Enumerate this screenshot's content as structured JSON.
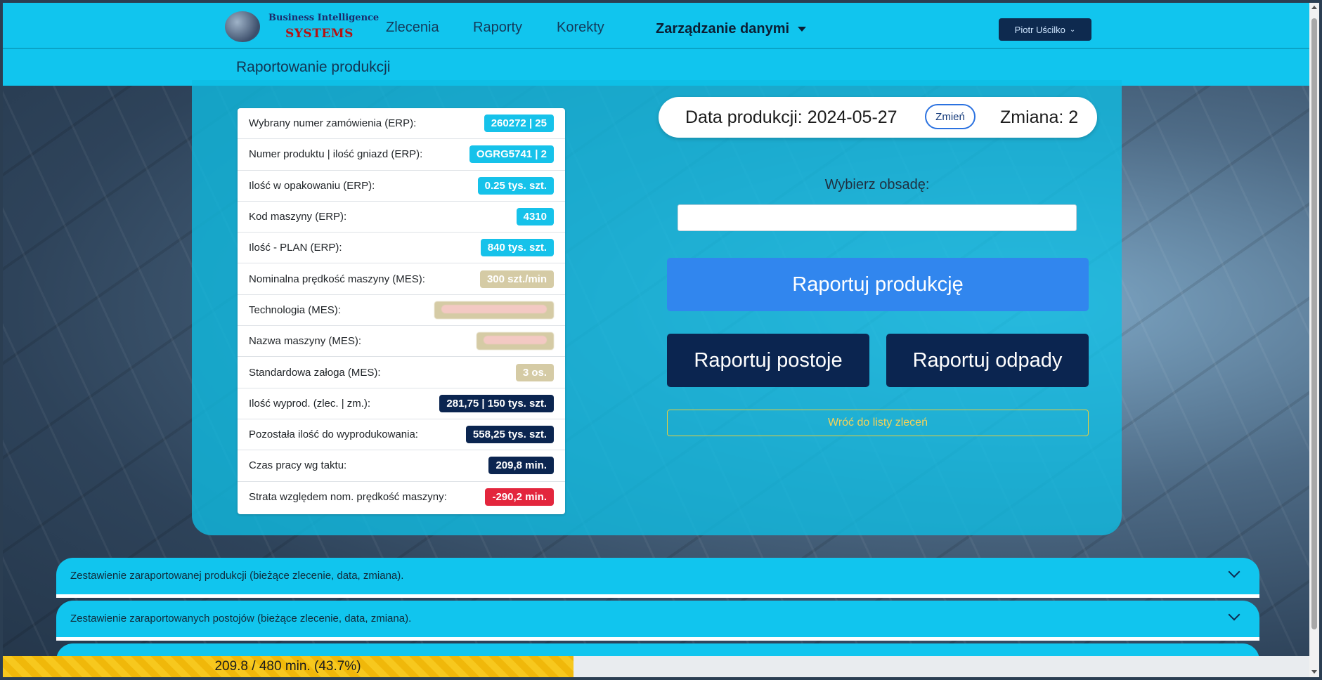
{
  "logo": {
    "line1": "Business Intelligence",
    "line2": "SYSTEMS"
  },
  "nav": {
    "links": [
      "Zlecenia",
      "Raporty",
      "Korekty"
    ],
    "dropdown": "Zarządzanie danymi",
    "user": "Piotr Uścilko"
  },
  "page_title": "Raportowanie produkcji",
  "info_rows": [
    {
      "label": "Wybrany numer zamówienia (ERP):",
      "value": "260272 | 25",
      "style": "info"
    },
    {
      "label": "Numer produktu | ilość gniazd (ERP):",
      "value": "OGRG5741 | 2",
      "style": "info"
    },
    {
      "label": "Ilość w opakowaniu (ERP):",
      "value": "0.25 tys. szt.",
      "style": "info"
    },
    {
      "label": "Kod maszyny (ERP):",
      "value": "4310",
      "style": "info"
    },
    {
      "label": "Ilość - PLAN (ERP):",
      "value": "840 tys. szt.",
      "style": "info"
    },
    {
      "label": "Nominalna prędkość maszyny (MES):",
      "value": "300 szt./min",
      "style": "tan"
    },
    {
      "label": "Technologia (MES):",
      "value": "",
      "style": "blur"
    },
    {
      "label": "Nazwa maszyny (MES):",
      "value": "",
      "style": "blur"
    },
    {
      "label": "Standardowa załoga (MES):",
      "value": "3 os.",
      "style": "tan"
    },
    {
      "label": "Ilość wyprod. (zlec. | zm.):",
      "value": "281,75 | 150 tys. szt.",
      "style": "dark"
    },
    {
      "label": "Pozostała ilość do wyprodukowania:",
      "value": "558,25 tys. szt.",
      "style": "dark"
    },
    {
      "label": "Czas pracy wg taktu:",
      "value": "209,8 min.",
      "style": "dark"
    },
    {
      "label": "Strata względem nom. prędkość maszyny:",
      "value": "-290,2 min.",
      "style": "red"
    }
  ],
  "production": {
    "date_label": "Data produkcji: 2024-05-27",
    "change_button": "Zmień",
    "shift_label": "Zmiana: 2"
  },
  "crew": {
    "label": "Wybierz obsadę:",
    "value": ""
  },
  "buttons": {
    "report_production": "Raportuj produkcję",
    "report_downtime": "Raportuj postoje",
    "report_waste": "Raportuj odpady",
    "back_to_orders": "Wróć do listy zleceń"
  },
  "accordions": [
    "Zestawienie zaraportowanej produkcji (bieżące zlecenie, data, zmiana).",
    "Zestawienie zaraportowanych postojów (bieżące zlecenie, data, zmiana)."
  ],
  "progress": {
    "text": "209.8 / 480 min. (43.7%)",
    "fraction": 0.437,
    "color": "#f7c81e"
  }
}
